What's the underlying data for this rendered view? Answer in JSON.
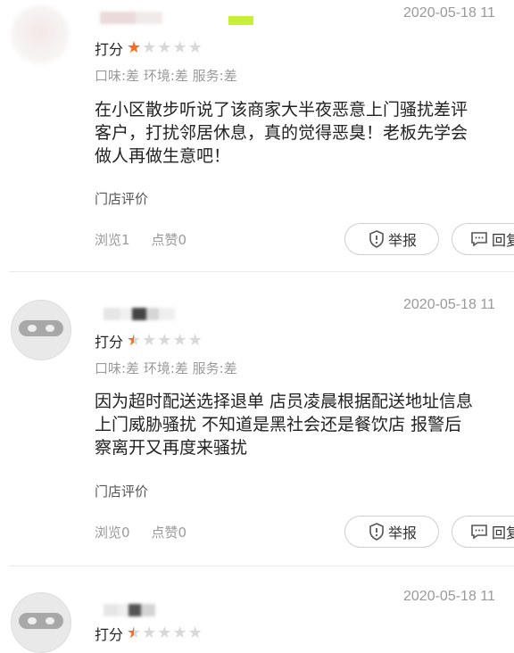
{
  "reviews": [
    {
      "date": "2020-05-18 11",
      "score_label": "打分",
      "star_rating": 1,
      "sub_ratings": "口味:差 环境:差 服务:差",
      "content_lines": [
        "在小区散步听说了该商家大半夜恶意上门骚扰差评",
        "客户，打扰邻居休息，真的觉得恶臭！老板先学会",
        "做人再做生意吧！"
      ],
      "store_eval_label": "门店评价",
      "views": "浏览1",
      "likes": "点赞0",
      "report_label": "举报",
      "reply_label": "回复"
    },
    {
      "date": "2020-05-18 11",
      "score_label": "打分",
      "star_rating": 0.5,
      "sub_ratings": "口味:差 环境:差 服务:差",
      "content_lines": [
        "因为超时配送选择退单 店员凌晨根据配送地址信息",
        "上门威胁骚扰 不知道是黑社会还是餐饮店 报警后",
        "察离开又再度来骚扰"
      ],
      "store_eval_label": "门店评价",
      "views": "浏览0",
      "likes": "点赞0",
      "report_label": "举报",
      "reply_label": "回复"
    },
    {
      "date": "2020-05-18 11",
      "score_label": "打分",
      "star_rating": 0.5
    }
  ],
  "colors": {
    "star_active": "#ff6a1a",
    "star_inactive": "#d8d8d8",
    "secondary_text": "#9a9a9a"
  },
  "icons": {
    "report": "shield-exclamation-icon",
    "reply": "comment-icon"
  }
}
